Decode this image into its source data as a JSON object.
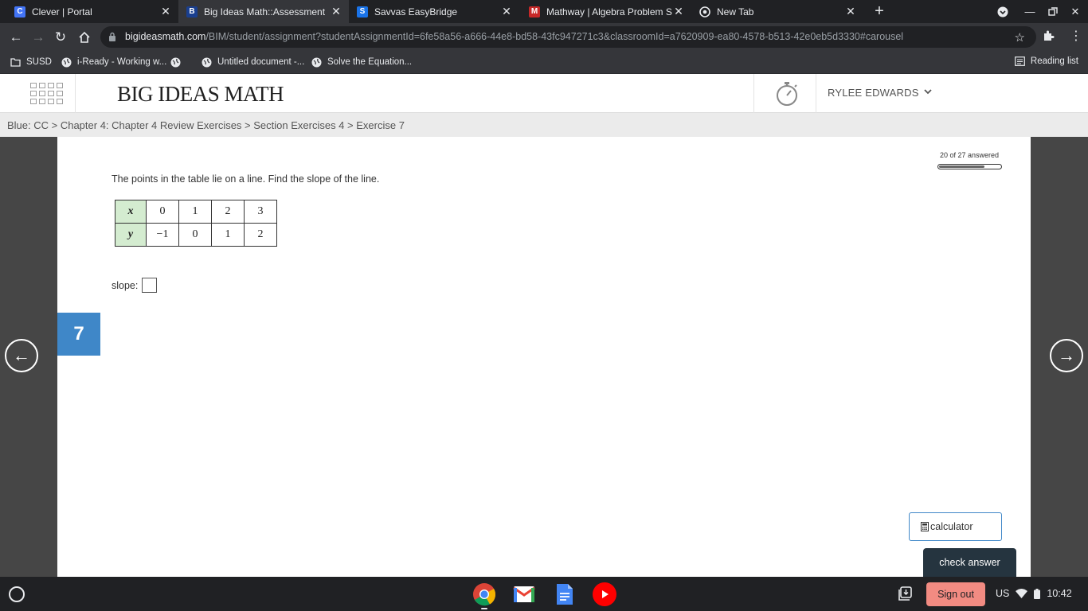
{
  "browser": {
    "tabs": [
      {
        "label": "Clever | Portal",
        "favicon": "C",
        "favicon_color": "#4274f6",
        "active": false
      },
      {
        "label": "Big Ideas Math::Assessment",
        "favicon": "B",
        "favicon_color": "#1a3f8f",
        "active": true
      },
      {
        "label": "Savvas EasyBridge",
        "favicon": "S",
        "favicon_color": "#1a73e8",
        "active": false
      },
      {
        "label": "Mathway | Algebra Problem Sol",
        "favicon": "M",
        "favicon_color": "#c62828",
        "active": false
      },
      {
        "label": "New Tab",
        "favicon": "",
        "favicon_color": "#e8eaed",
        "active": false
      }
    ],
    "url_host": "bigideasmath.com",
    "url_path": "/BIM/student/assignment?studentAssignmentId=6fe58a56-a666-44e8-bd58-43fc947271c3&classroomId=a7620909-ea80-4578-b513-42e0eb5d3330#carousel",
    "bookmarks": [
      {
        "label": "SUSD",
        "icon": "folder-icon"
      },
      {
        "label": "i-Ready - Working w...",
        "icon": "globe-icon"
      },
      {
        "label": "",
        "icon": "globe-icon"
      },
      {
        "label": "Untitled document -...",
        "icon": "globe-icon"
      },
      {
        "label": "Solve the Equation...",
        "icon": "globe-icon"
      }
    ],
    "reading_list": "Reading list"
  },
  "app": {
    "brand": "BIG IDEAS MATH",
    "user_name": "RYLEE EDWARDS",
    "breadcrumb": "Blue: CC > Chapter 4: Chapter 4 Review Exercises > Section Exercises 4 > Exercise 7"
  },
  "assessment": {
    "progress_text": "20 of 27 answered",
    "progress_fraction": 0.74,
    "question": "The points in the table lie on a line. Find the slope of the line.",
    "table": {
      "x_label": "x",
      "y_label": "y",
      "x_values": [
        "0",
        "1",
        "2",
        "3"
      ],
      "y_values": [
        "−1",
        "0",
        "1",
        "2"
      ]
    },
    "slope_label": "slope:",
    "slope_value": "",
    "exercise_number": "7",
    "calculator_label": "calculator",
    "check_answer_label": "check answer"
  },
  "shelf": {
    "sign_out": "Sign out",
    "locale": "US",
    "time": "10:42"
  },
  "colors": {
    "accent_blue": "#3f87c8",
    "table_header_green": "#d4ecd0",
    "check_button": "#25343f",
    "sign_out": "#f28b82"
  }
}
